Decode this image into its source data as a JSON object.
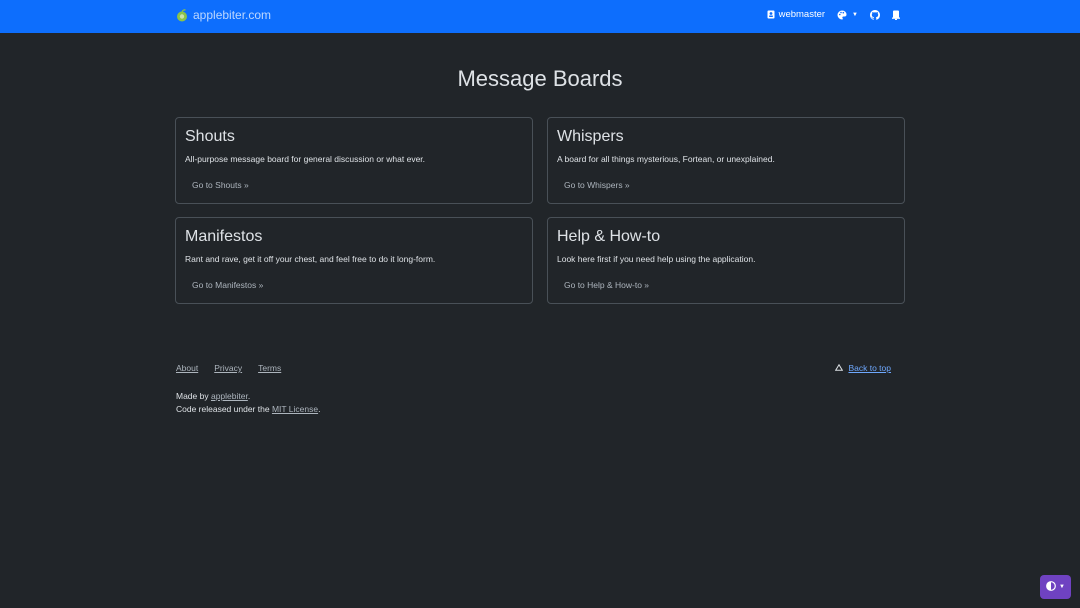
{
  "navbar": {
    "brand": "applebiter.com",
    "user_label": "webmaster"
  },
  "main": {
    "title": "Message Boards",
    "boards": [
      {
        "title": "Shouts",
        "description": "All-purpose message board for general discussion or what ever.",
        "link": "Go to Shouts »"
      },
      {
        "title": "Whispers",
        "description": "A board for all things mysterious, Fortean, or unexplained.",
        "link": "Go to Whispers »"
      },
      {
        "title": "Manifestos",
        "description": "Rant and rave, get it off your chest, and feel free to do it long-form.",
        "link": "Go to Manifestos »"
      },
      {
        "title": "Help & How-to",
        "description": "Look here first if you need help using the application.",
        "link": "Go to Help & How-to »"
      }
    ]
  },
  "footer": {
    "links": [
      "About",
      "Privacy",
      "Terms"
    ],
    "back_to_top": "Back to top",
    "made_by_prefix": "Made by ",
    "made_by_link": "applebiter",
    "made_by_suffix": ".",
    "license_prefix": "Code released under the ",
    "license_link": "MIT License",
    "license_suffix": "."
  },
  "colors": {
    "navbar": "#0d6efd",
    "background": "#212529",
    "theme_toggle": "#6f42c1",
    "link_accent": "#6ea8fe"
  },
  "icons": {
    "brand": "apple-logo-icon",
    "user": "user-badge-icon",
    "theme": "palette-icon",
    "github": "github-icon",
    "notifications": "bell-icon",
    "back_to_top": "triangle-up-icon",
    "contrast": "contrast-icon"
  }
}
